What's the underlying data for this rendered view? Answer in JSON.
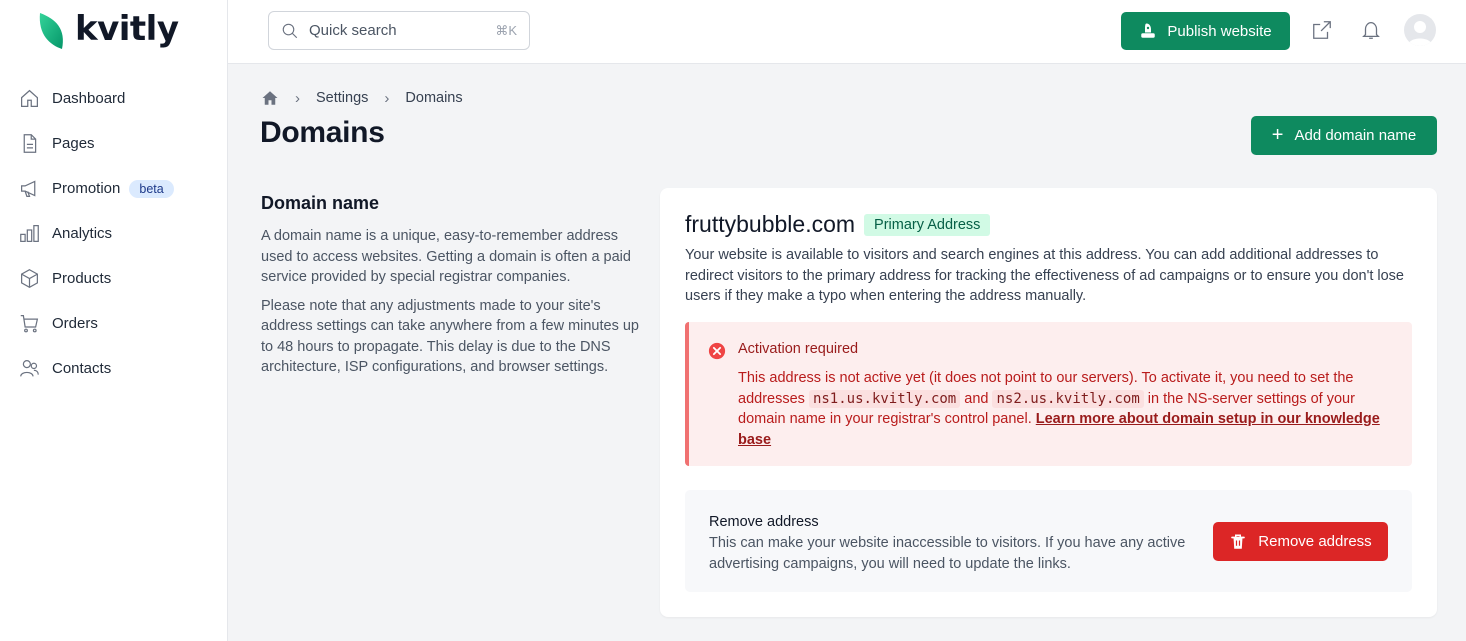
{
  "app": {
    "logo_text": "kvitly"
  },
  "sidebar": {
    "items": [
      {
        "label": "Dashboard",
        "icon": "home-icon"
      },
      {
        "label": "Pages",
        "icon": "file-icon"
      },
      {
        "label": "Promotion",
        "icon": "megaphone-icon",
        "badge": "beta"
      },
      {
        "label": "Analytics",
        "icon": "bar-chart-icon"
      },
      {
        "label": "Products",
        "icon": "box-icon"
      },
      {
        "label": "Orders",
        "icon": "cart-icon"
      },
      {
        "label": "Contacts",
        "icon": "users-icon"
      }
    ]
  },
  "topbar": {
    "search_placeholder": "Quick search",
    "search_shortcut": "⌘K",
    "publish_label": "Publish website"
  },
  "breadcrumb": {
    "items": [
      "Settings",
      "Domains"
    ]
  },
  "page": {
    "title": "Domains",
    "add_button": "Add domain name"
  },
  "info": {
    "title": "Domain name",
    "p1": "A domain name is a unique, easy-to-remember address used to access websites. Getting a domain is often a paid service provided by special registrar companies.",
    "p2": "Please note that any adjustments made to your site's address settings can take anywhere from a few minutes up to 48 hours to propagate. This delay is due to the DNS architecture, ISP configurations, and browser settings."
  },
  "domain": {
    "name": "fruttybubble.com",
    "badge": "Primary Address",
    "description": "Your website is available to visitors and search engines at this address. You can add additional addresses to redirect visitors to the primary address for tracking the effectiveness of ad campaigns or to ensure you don't lose users if they make a typo when entering the address manually."
  },
  "alert": {
    "title": "Activation required",
    "body_1": "This address is not active yet (it does not point to our servers). To activate it, you need to set the addresses ",
    "ns1": "ns1.us.kvitly.com",
    "and": " and ",
    "ns2": "ns2.us.kvitly.com",
    "body_2": " in the NS-server settings of your domain name in your registrar's control panel. ",
    "link": "Learn more about domain setup in our knowledge base"
  },
  "remove": {
    "title": "Remove address",
    "description": "This can make your website inaccessible to visitors. If you have any active advertising campaigns, you will need to update the links.",
    "button": "Remove address"
  },
  "colors": {
    "brand_green": "#0e8a5f",
    "danger": "#dc2626",
    "alert_bg": "#fdeeee",
    "badge_green_bg": "#d1fae5"
  }
}
